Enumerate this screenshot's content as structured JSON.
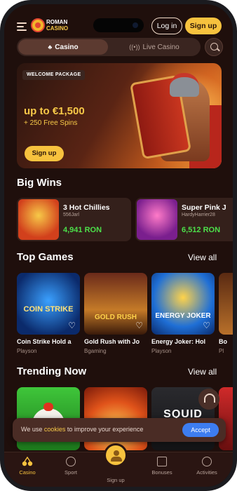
{
  "header": {
    "logo_top": "ROMAN",
    "logo_bottom": "CASINO",
    "login_label": "Log in",
    "signup_label": "Sign up"
  },
  "tabs": [
    {
      "label": "Casino",
      "icon": "cherries-icon",
      "active": true
    },
    {
      "label": "Live Casino",
      "icon": "live-broadcast-icon",
      "active": false
    }
  ],
  "hero": {
    "badge": "WELCOME PACKAGE",
    "amount": "up to €1,500",
    "spins": "+ 250 Free Spins",
    "cta": "Sign up"
  },
  "big_wins": {
    "title": "Big Wins",
    "items": [
      {
        "game": "3 Hot Chillies",
        "user": "556Jarl",
        "amount": "4,941 RON"
      },
      {
        "game": "Super Pink J",
        "user": "HardyHarrier28",
        "amount": "6,512 RON"
      }
    ]
  },
  "top_games": {
    "title": "Top Games",
    "view_all": "View all",
    "items": [
      {
        "title": "Coin Strike Hold a",
        "provider": "Playson",
        "art": "COIN STRIKE"
      },
      {
        "title": "Gold Rush with Jo",
        "provider": "Bgaming",
        "art": "GOLD RUSH"
      },
      {
        "title": "Energy Joker: Hol",
        "provider": "Playson",
        "art": "ENERGY JOKER"
      },
      {
        "title": "Bo",
        "provider": "Pl",
        "art": ""
      }
    ]
  },
  "trending": {
    "title": "Trending Now",
    "view_all": "View all",
    "items": [
      {
        "art": ""
      },
      {
        "art": ""
      },
      {
        "art": "SQUID"
      },
      {
        "art": ""
      }
    ]
  },
  "cookie": {
    "text_before": "We use ",
    "link": "cookies",
    "text_after": " to improve your experience",
    "accept": "Accept"
  },
  "bottom_nav": [
    {
      "label": "Casino",
      "icon": "cherries-icon",
      "active": true
    },
    {
      "label": "Sport",
      "icon": "football-icon",
      "active": false
    },
    {
      "label": "Sign up",
      "icon": "user-icon",
      "active": false
    },
    {
      "label": "Bonuses",
      "icon": "gift-icon",
      "active": false
    },
    {
      "label": "Activities",
      "icon": "target-icon",
      "active": false
    }
  ],
  "colors": {
    "background": "#1f0f0c",
    "accent": "#f7c23e",
    "win_amount": "#4ce04a",
    "cookie_accept": "#3d7df0"
  }
}
